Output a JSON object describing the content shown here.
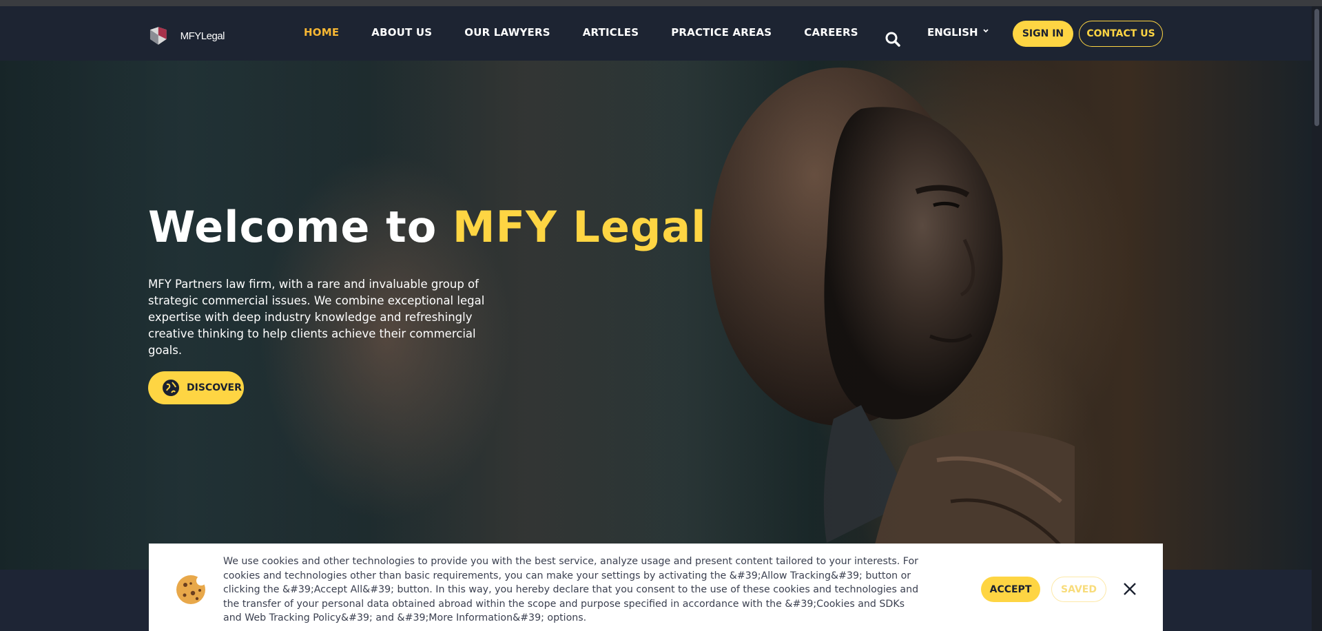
{
  "header": {
    "logo_text": "MFYLegal",
    "nav": [
      {
        "label": "HOME",
        "active": true
      },
      {
        "label": "ABOUT US"
      },
      {
        "label": "OUR LAWYERS"
      },
      {
        "label": "ARTICLES"
      },
      {
        "label": "PRACTICE AREAS"
      },
      {
        "label": "CAREERS"
      }
    ],
    "language": "ENGLISH",
    "sign_in": "SIGN IN",
    "contact_us": "CONTACT US",
    "icons": {
      "search": "search-icon",
      "chevron": "chevron-down-icon"
    }
  },
  "hero": {
    "title_prefix": "Welcome to ",
    "title_accent": "MFY Legal",
    "description": "MFY Partners law firm, with a rare and invaluable group of strategic commercial issues. We combine exceptional legal expertise with deep industry knowledge and refreshingly creative thinking to help clients achieve their commercial goals.",
    "discover_label": "DISCOVER",
    "discover_icon": "globe-icon"
  },
  "cookie_banner": {
    "text": "We use cookies and other technologies to provide you with the best service, analyze usage and present content tailored to your interests. For cookies and technologies other than basic requirements, you can make your settings by activating the &#39;Allow Tracking&#39; button or clicking the &#39;Accept All&#39; button. In this way, you hereby declare that you consent to the use of these cookies and technologies and the transfer of your personal data obtained abroad within the scope and purpose specified in accordance with the &#39;Cookies and SDKs and Web Tracking Policy&#39; and &#39;More Information&#39; options.",
    "accept": "ACCEPT",
    "saved": "SAVED",
    "icon": "cookie-icon",
    "close_icon": "close-icon"
  },
  "colors": {
    "accent": "#fed543",
    "nav_active": "#f7b733",
    "header_bg": "#1d2432"
  }
}
